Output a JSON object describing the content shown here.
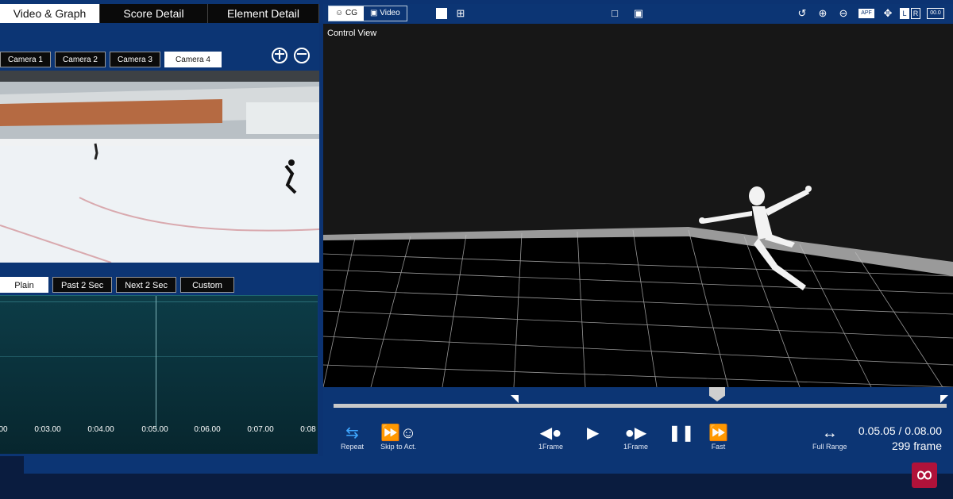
{
  "left": {
    "main_tabs": [
      "Video & Graph",
      "Score Detail",
      "Element Detail"
    ],
    "camera_tabs": [
      "Camera 1",
      "Camera 2",
      "Camera 3",
      "Camera 4"
    ],
    "graph_tabs": [
      "Plain",
      "Past 2 Sec",
      "Next 2 Sec",
      "Custom"
    ],
    "time_ticks": [
      "00",
      "0:03.00",
      "0:04.00",
      "0:05.00",
      "0:06.00",
      "0:07.00",
      "0:08"
    ]
  },
  "right": {
    "view_toggle": {
      "cg": "CG",
      "video": "Video"
    },
    "toolbar_labels": {
      "apf": "APF",
      "l": "L",
      "r": "R",
      "box": "00.0"
    },
    "view_label": "Control View",
    "controls": {
      "repeat": "Repeat",
      "skip": "Skip to Act.",
      "back_frame": "1Frame",
      "fwd_frame": "1Frame",
      "fast": "Fast",
      "full_range": "Full Range"
    },
    "time": "0.05.05 / 0.08.00",
    "frame": "299 frame"
  },
  "colors": {
    "accent": "#0c3574",
    "logo": "#b0123a"
  }
}
